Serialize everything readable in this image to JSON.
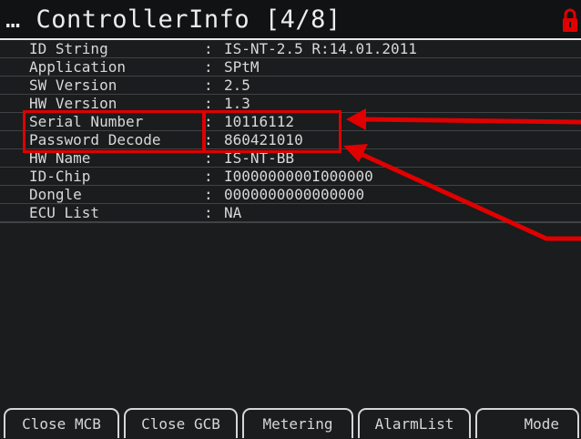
{
  "header": {
    "title": "… ControllerInfo [4/8]",
    "lock_icon": "lock-icon",
    "lock_color": "#e00000"
  },
  "rows": [
    {
      "label": "ID String",
      "sep": ":",
      "value": "IS-NT-2.5 R:14.01.2011"
    },
    {
      "label": "Application",
      "sep": ":",
      "value": "SPtM"
    },
    {
      "label": "SW Version",
      "sep": ":",
      "value": "2.5"
    },
    {
      "label": "HW Version",
      "sep": ":",
      "value": "1.3"
    },
    {
      "label": "Serial Number",
      "sep": ":",
      "value": "10116112"
    },
    {
      "label": "Password Decode",
      "sep": ":",
      "value": "860421010"
    },
    {
      "label": "HW Name",
      "sep": ":",
      "value": "IS-NT-BB"
    },
    {
      "label": "ID-Chip",
      "sep": ":",
      "value": "I000000000I000000"
    },
    {
      "label": "Dongle",
      "sep": ":",
      "value": "0000000000000000"
    },
    {
      "label": "ECU List",
      "sep": ":",
      "value": "NA"
    }
  ],
  "annotation": {
    "color": "#e00000",
    "highlighted_rows": [
      "Serial Number",
      "Password Decode"
    ]
  },
  "softkeys": [
    {
      "label": "Close MCB"
    },
    {
      "label": "Close GCB"
    },
    {
      "label": "Metering"
    },
    {
      "label": "AlarmList"
    },
    {
      "label": "Mode"
    }
  ]
}
